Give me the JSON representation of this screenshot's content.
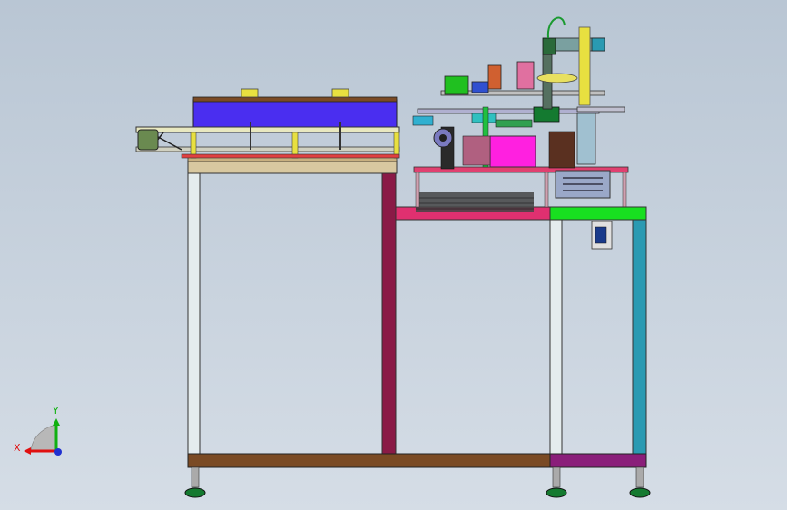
{
  "view": {
    "background_top": "#b9c6d4",
    "background_bottom": "#d5dde6"
  },
  "triad": {
    "x_label": "X",
    "y_label": "Y",
    "x_color": "#e01010",
    "y_color": "#10b010",
    "z_color": "#2030d0"
  },
  "colors": {
    "frame_white": "#e4ecee",
    "frame_maroon": "#8a1a46",
    "frame_teal": "#2a9ab2",
    "base_brown": "#7a4a24",
    "base_purple": "#8a1e7a",
    "conveyor_blue": "#4a2ef0",
    "plate_red": "#e03070",
    "plate_green": "#18e020",
    "box_magenta": "#ff20e0",
    "motor_green": "#6a8a50",
    "yellow_part": "#e8e040",
    "tan_plate": "#d8c8a0",
    "slider_gray": "#9aa8c8",
    "dark_green": "#147a30"
  }
}
